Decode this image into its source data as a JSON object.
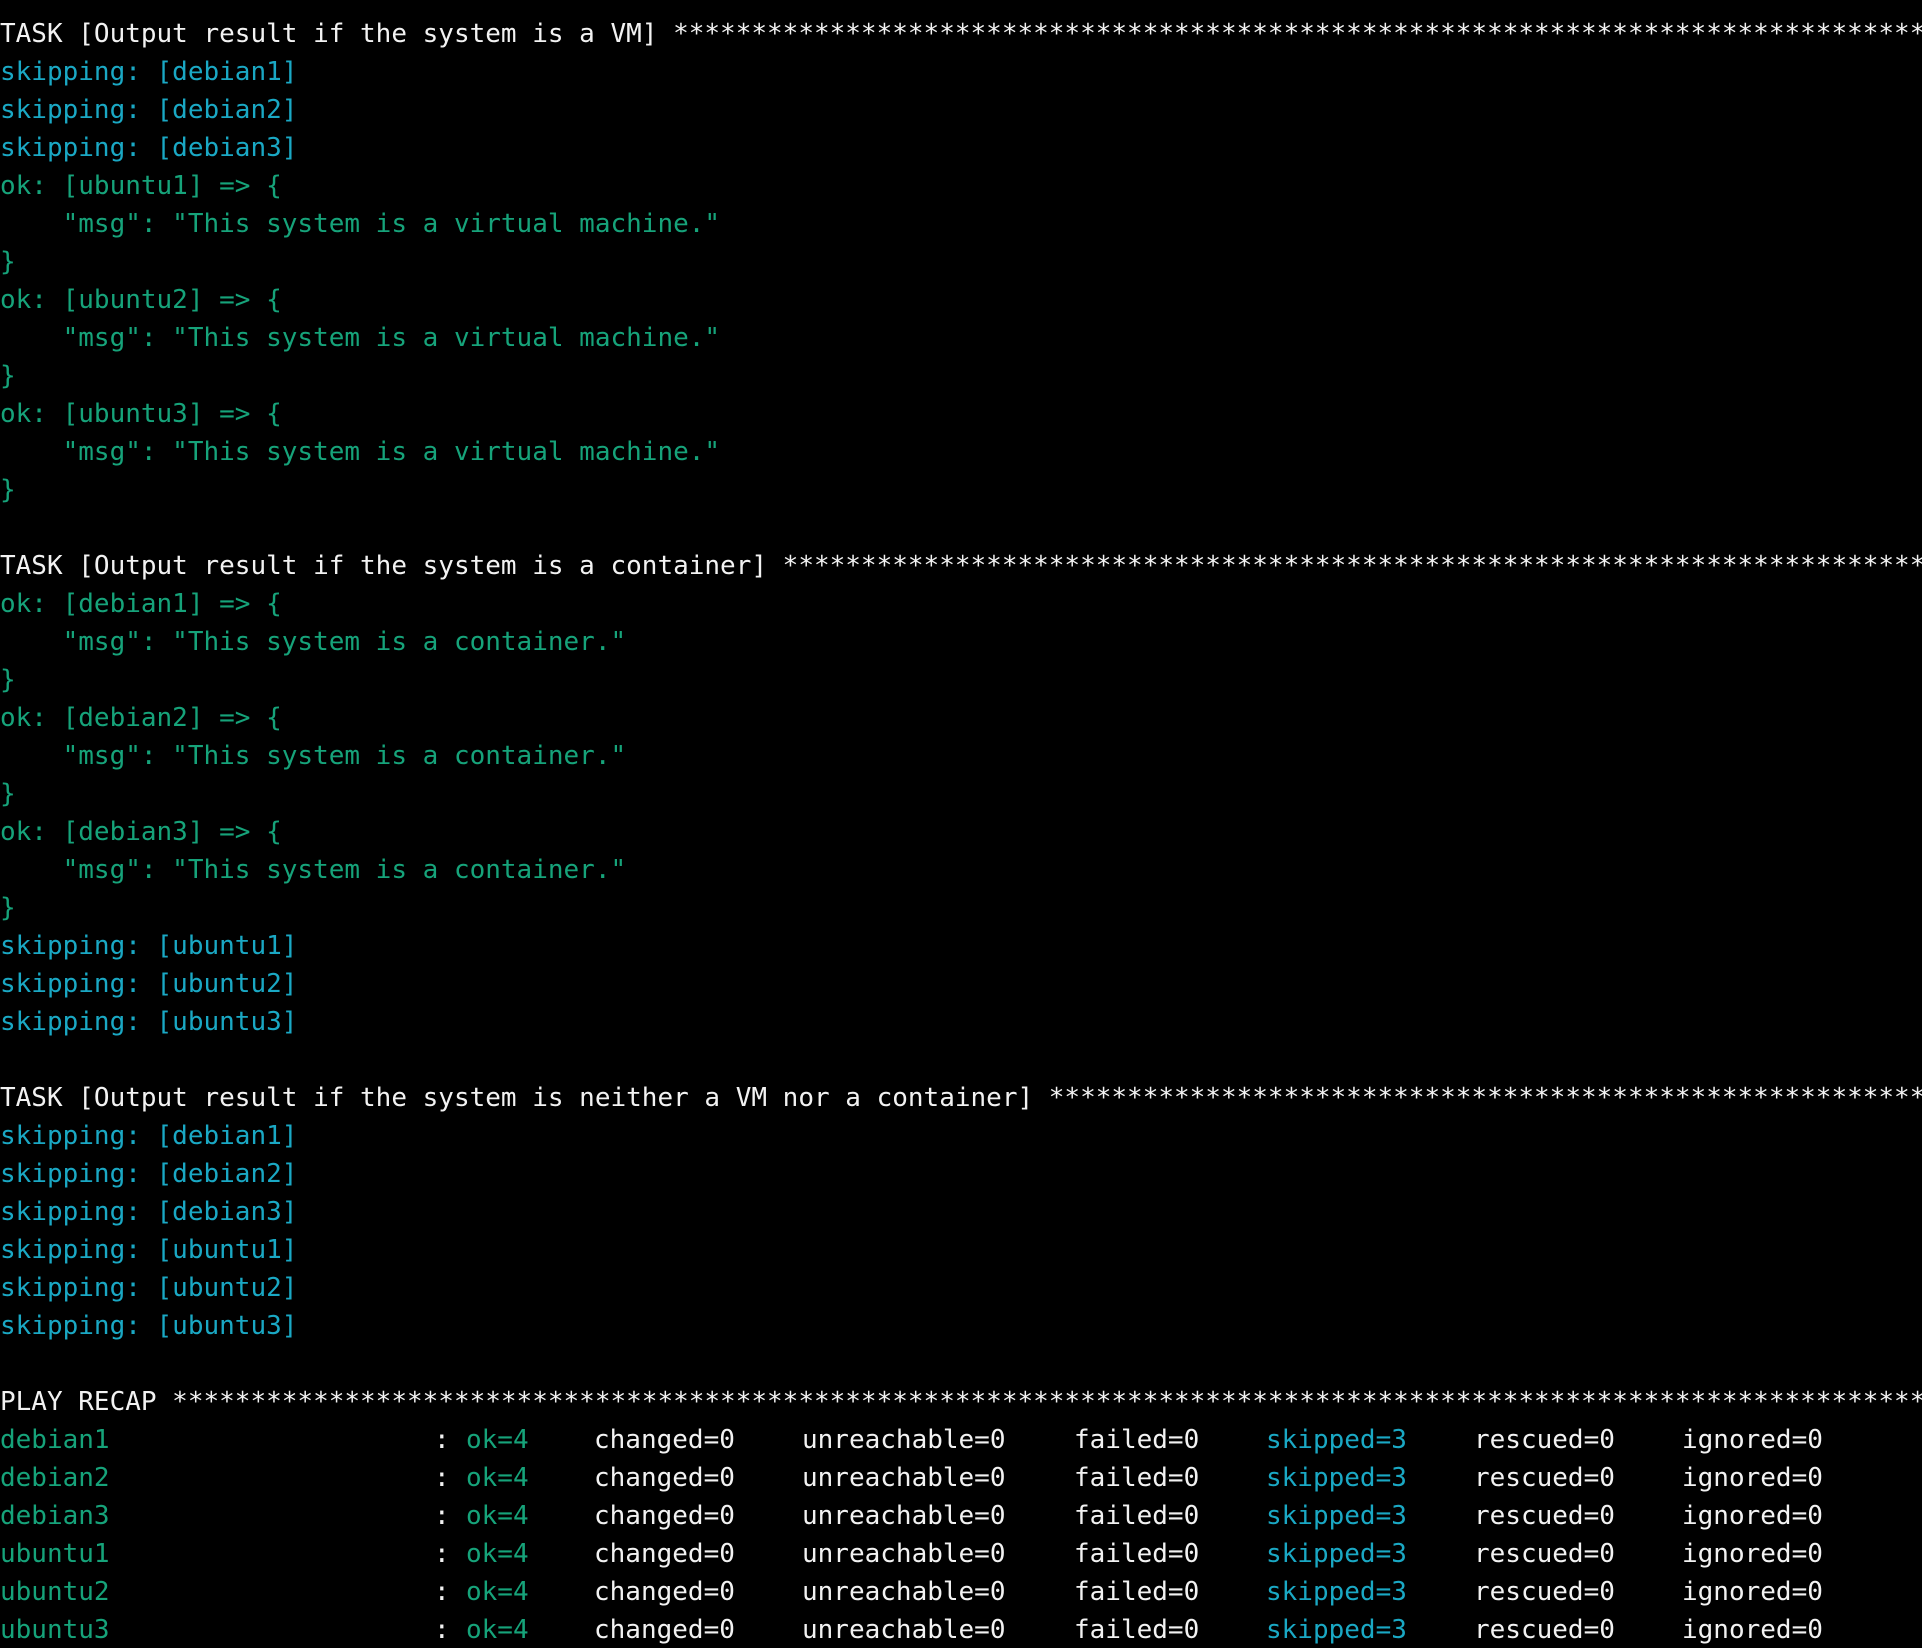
{
  "colors": {
    "background": "#000000",
    "default_text": "#f2f2f2",
    "ok": "#16a37a",
    "skipping": "#1aa8c4"
  },
  "lines": [
    {
      "text": "TASK [Output result if the system is a VM] *****************************************************************************************",
      "color": "white"
    },
    {
      "text": "skipping: [debian1]",
      "color": "cyan"
    },
    {
      "text": "skipping: [debian2]",
      "color": "cyan"
    },
    {
      "text": "skipping: [debian3]",
      "color": "cyan"
    },
    {
      "text": "ok: [ubuntu1] => {",
      "color": "green"
    },
    {
      "text": "    \"msg\": \"This system is a virtual machine.\"",
      "color": "green"
    },
    {
      "text": "}",
      "color": "green"
    },
    {
      "text": "ok: [ubuntu2] => {",
      "color": "green"
    },
    {
      "text": "    \"msg\": \"This system is a virtual machine.\"",
      "color": "green"
    },
    {
      "text": "}",
      "color": "green"
    },
    {
      "text": "ok: [ubuntu3] => {",
      "color": "green"
    },
    {
      "text": "    \"msg\": \"This system is a virtual machine.\"",
      "color": "green"
    },
    {
      "text": "}",
      "color": "green"
    },
    {
      "text": "",
      "color": "white"
    },
    {
      "text": "TASK [Output result if the system is a container] *****************************************************************************************",
      "color": "white"
    },
    {
      "text": "ok: [debian1] => {",
      "color": "green"
    },
    {
      "text": "    \"msg\": \"This system is a container.\"",
      "color": "green"
    },
    {
      "text": "}",
      "color": "green"
    },
    {
      "text": "ok: [debian2] => {",
      "color": "green"
    },
    {
      "text": "    \"msg\": \"This system is a container.\"",
      "color": "green"
    },
    {
      "text": "}",
      "color": "green"
    },
    {
      "text": "ok: [debian3] => {",
      "color": "green"
    },
    {
      "text": "    \"msg\": \"This system is a container.\"",
      "color": "green"
    },
    {
      "text": "}",
      "color": "green"
    },
    {
      "text": "skipping: [ubuntu1]",
      "color": "cyan"
    },
    {
      "text": "skipping: [ubuntu2]",
      "color": "cyan"
    },
    {
      "text": "skipping: [ubuntu3]",
      "color": "cyan"
    },
    {
      "text": "",
      "color": "white"
    },
    {
      "text": "TASK [Output result if the system is neither a VM nor a container] *****************************************************************************************",
      "color": "white"
    },
    {
      "text": "skipping: [debian1]",
      "color": "cyan"
    },
    {
      "text": "skipping: [debian2]",
      "color": "cyan"
    },
    {
      "text": "skipping: [debian3]",
      "color": "cyan"
    },
    {
      "text": "skipping: [ubuntu1]",
      "color": "cyan"
    },
    {
      "text": "skipping: [ubuntu2]",
      "color": "cyan"
    },
    {
      "text": "skipping: [ubuntu3]",
      "color": "cyan"
    },
    {
      "text": "",
      "color": "white"
    },
    {
      "text": "PLAY RECAP *****************************************************************************************************************************",
      "color": "white"
    }
  ],
  "recap": [
    {
      "host": "debian1",
      "sep": ":",
      "ok": "ok=4",
      "changed": "changed=0",
      "unreachable": "unreachable=0",
      "failed": "failed=0",
      "skipped": "skipped=3",
      "rescued": "rescued=0",
      "ignored": "ignored=0"
    },
    {
      "host": "debian2",
      "sep": ":",
      "ok": "ok=4",
      "changed": "changed=0",
      "unreachable": "unreachable=0",
      "failed": "failed=0",
      "skipped": "skipped=3",
      "rescued": "rescued=0",
      "ignored": "ignored=0"
    },
    {
      "host": "debian3",
      "sep": ":",
      "ok": "ok=4",
      "changed": "changed=0",
      "unreachable": "unreachable=0",
      "failed": "failed=0",
      "skipped": "skipped=3",
      "rescued": "rescued=0",
      "ignored": "ignored=0"
    },
    {
      "host": "ubuntu1",
      "sep": ":",
      "ok": "ok=4",
      "changed": "changed=0",
      "unreachable": "unreachable=0",
      "failed": "failed=0",
      "skipped": "skipped=3",
      "rescued": "rescued=0",
      "ignored": "ignored=0"
    },
    {
      "host": "ubuntu2",
      "sep": ":",
      "ok": "ok=4",
      "changed": "changed=0",
      "unreachable": "unreachable=0",
      "failed": "failed=0",
      "skipped": "skipped=3",
      "rescued": "rescued=0",
      "ignored": "ignored=0"
    },
    {
      "host": "ubuntu3",
      "sep": ":",
      "ok": "ok=4",
      "changed": "changed=0",
      "unreachable": "unreachable=0",
      "failed": "failed=0",
      "skipped": "skipped=3",
      "rescued": "rescued=0",
      "ignored": "ignored=0"
    }
  ]
}
